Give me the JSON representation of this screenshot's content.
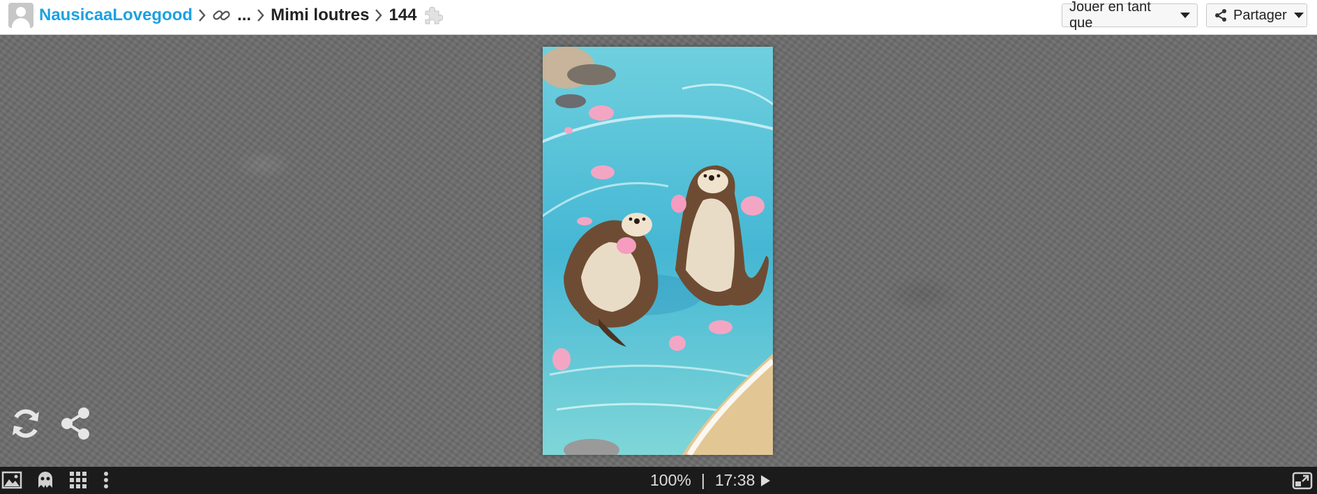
{
  "breadcrumb": {
    "user": "NausicaaLovegood",
    "ellipsis": "...",
    "collection": "Mimi loutres",
    "piece_count": "144"
  },
  "header_buttons": {
    "play_as": "Jouer en tant que",
    "share": "Partager"
  },
  "footer": {
    "zoom": "100%",
    "divider": "|",
    "timer": "17:38"
  },
  "icons": {
    "avatar": "user-avatar",
    "chain": "link-icon",
    "puzzle": "puzzle-piece-icon",
    "refresh": "refresh-icon",
    "share_float": "share-icon",
    "image": "image-icon",
    "ghost": "ghost-icon",
    "grid": "grid-icon",
    "more": "more-vertical-icon",
    "play": "play-icon",
    "expand": "expand-icon"
  },
  "colors": {
    "user_link": "#1da1e0",
    "background": "#6f6f6f",
    "footer": "#1b1b1b"
  }
}
